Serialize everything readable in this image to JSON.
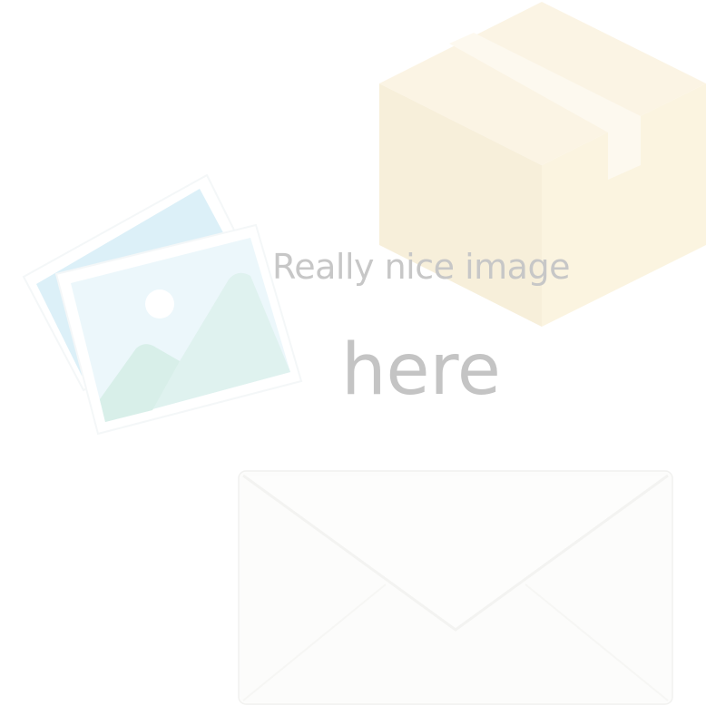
{
  "placeholder": {
    "line1": "Really nice image",
    "line2": "here"
  },
  "icons": [
    "box-icon",
    "photos-icon",
    "envelope-icon"
  ],
  "colors": {
    "background": "#ffffff",
    "text": "#c6c6c6",
    "box_top": "#fbf4e2",
    "box_left": "#f7efda",
    "box_right": "#fbf4e0",
    "photo_back": "#dcf0f8",
    "photo_front_sky": "#ecf7fb",
    "photo_mountain": "#dff2ef",
    "envelope": "#fcfcfb"
  }
}
